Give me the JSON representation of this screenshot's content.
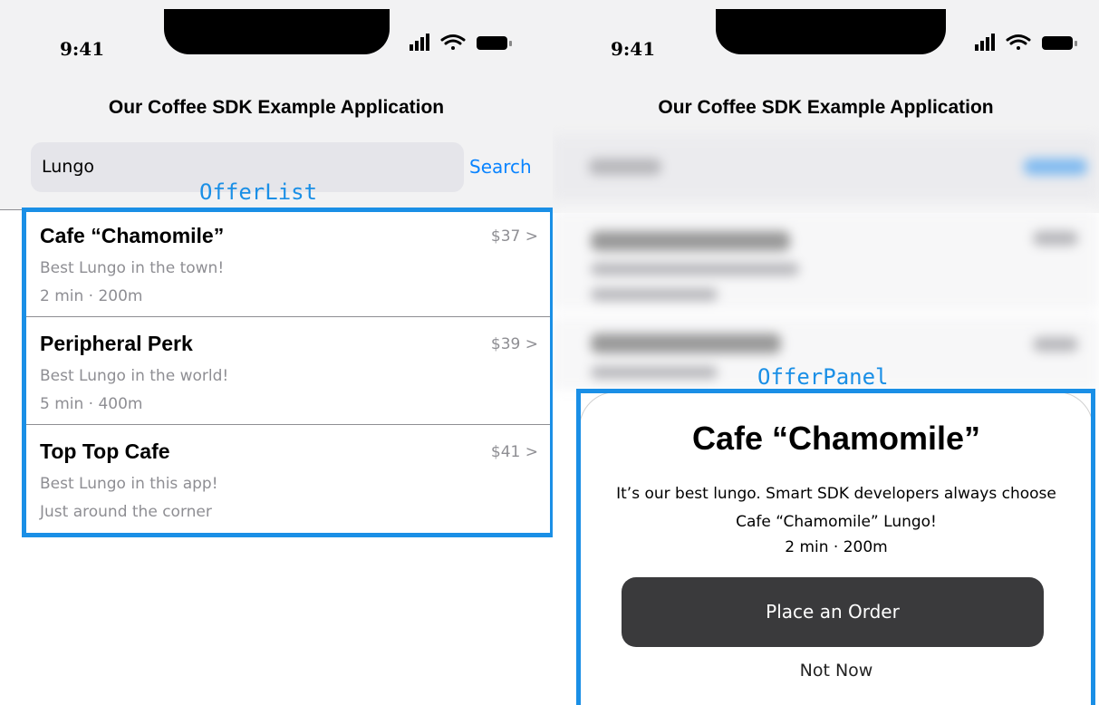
{
  "status_bar": {
    "time": "9:41",
    "icons": [
      "signal-icon",
      "wifi-icon",
      "battery-icon"
    ]
  },
  "app": {
    "title": "Our Coffee SDK Example Application"
  },
  "search": {
    "value": "Lungo",
    "button_label": "Search"
  },
  "labels": {
    "offer_list": "OfferList",
    "offer_panel": "OfferPanel"
  },
  "offers": [
    {
      "name": "Cafe “Chamomile”",
      "description": "Best Lungo in the town!",
      "meta": "2 min · 200m",
      "price": "$37 >"
    },
    {
      "name": "Peripheral Perk",
      "description": "Best Lungo in the world!",
      "meta": "5 min · 400m",
      "price": "$39 >"
    },
    {
      "name": "Top Top Cafe",
      "description": "Best Lungo in this app!",
      "meta": "Just around the corner",
      "price": "$41 >"
    }
  ],
  "panel": {
    "title": "Cafe “Chamomile”",
    "description": "It’s our best lungo. Smart SDK developers always choose Cafe “Chamomile” Lungo!",
    "meta": "2 min · 200m",
    "order_button": "Place an Order",
    "dismiss_button": "Not Now"
  },
  "colors": {
    "accent": "#0a84ff",
    "highlight": "#1a8fe6",
    "button_dark": "#3a3a3c"
  }
}
